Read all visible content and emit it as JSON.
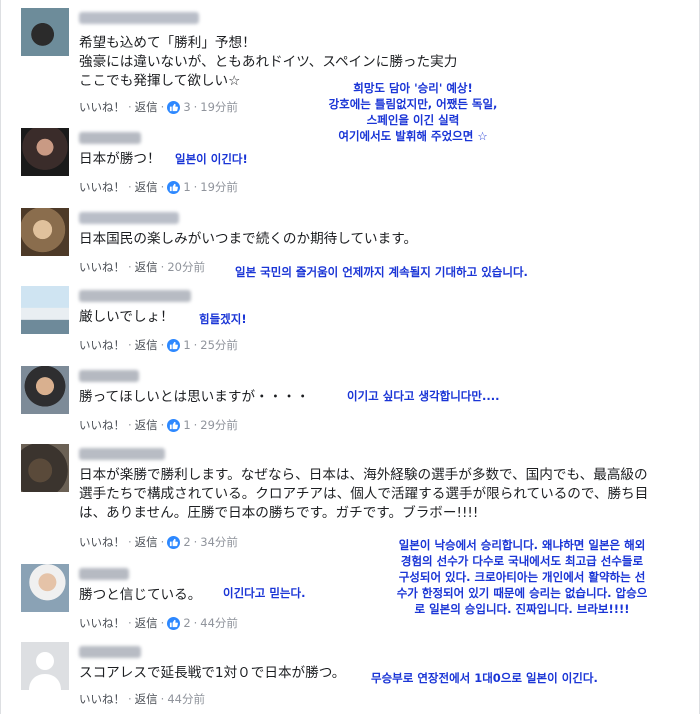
{
  "comments": [
    {
      "lines": [
        "希望も込めて「勝利」予想！",
        "強豪には違いないが、ともあれドイツ、スペインに勝った実力",
        "ここでも発揮して欲しい☆"
      ],
      "like": "いいね！",
      "reply": "返信",
      "likes": "3",
      "time": "19分前"
    },
    {
      "lines": [
        "日本が勝つ！"
      ],
      "like": "いいね！",
      "reply": "返信",
      "likes": "1",
      "time": "19分前"
    },
    {
      "lines": [
        "日本国民の楽しみがいつまで続くのか期待しています。"
      ],
      "like": "いいね！",
      "reply": "返信",
      "likes": "",
      "time": "20分前"
    },
    {
      "lines": [
        "厳しいでしょ！"
      ],
      "like": "いいね！",
      "reply": "返信",
      "likes": "1",
      "time": "25分前"
    },
    {
      "lines": [
        "勝ってほしいとは思いますが・・・・"
      ],
      "like": "いいね！",
      "reply": "返信",
      "likes": "1",
      "time": "29分前"
    },
    {
      "lines": [
        "日本が楽勝で勝利します。なぜなら、日本は、海外経験の選手が多数で、国内でも、最高級の",
        "選手たちで構成されている。クロアチアは、個人で活躍する選手が限られているので、勝ち目",
        "は、ありません。圧勝で日本の勝ちです。ガチです。ブラボー!!!!"
      ],
      "like": "いいね！",
      "reply": "返信",
      "likes": "2",
      "time": "34分前"
    },
    {
      "lines": [
        "勝つと信じている。"
      ],
      "like": "いいね！",
      "reply": "返信",
      "likes": "2",
      "time": "44分前"
    },
    {
      "lines": [
        "スコアレスで延長戦で1対０で日本が勝つ。"
      ],
      "like": "いいね！",
      "reply": "返信",
      "likes": "",
      "time": "44分前"
    }
  ],
  "translations": {
    "t1": [
      "희망도 담아 '승리' 예상!",
      "강호에는 틀림없지만, 어쨌든 독일,",
      "스페인을 이긴 실력",
      "여기에서도 발휘해 주었으면 ☆"
    ],
    "t2": "일본이 이긴다!",
    "t3": "일본 국민의 즐거움이 언제까지 계속될지 기대하고 있습니다.",
    "t4": "힘들겠지!",
    "t5": "이기고 싶다고 생각합니다만....",
    "t6": [
      "일본이 낙승에서 승리합니다. 왜냐하면 일본은 해외",
      "경험의 선수가 다수로 국내에서도 최고급 선수들로",
      "구성되어 있다. 크로아티아는 개인에서 활약하는 선",
      "수가 한정되어 있기 때문에 승리는 없습니다. 압승으",
      "로 일본의 승입니다. 진짜입니다. 브라보!!!!"
    ],
    "t7": "이긴다고 믿는다.",
    "t8": "무승부로 연장전에서 1대0으로 일본이 이긴다."
  },
  "colors": {
    "like_badge": "#2d88ff",
    "translation_text": "#1a35d6",
    "meta_text": "#90949c"
  }
}
